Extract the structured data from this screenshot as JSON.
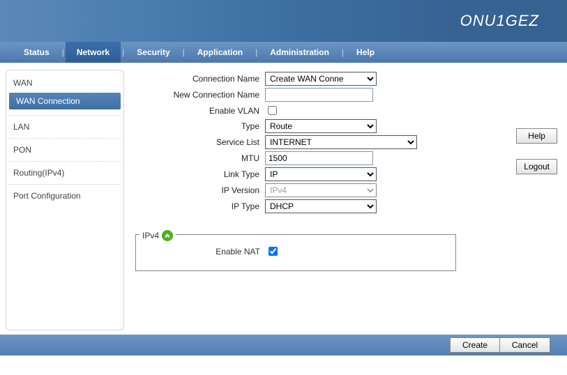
{
  "brand": "ONU1GEZ",
  "menu": {
    "items": [
      "Status",
      "Network",
      "Security",
      "Application",
      "Administration",
      "Help"
    ],
    "active": "Network"
  },
  "sidebar": {
    "groups": [
      {
        "name": "WAN",
        "sub": [
          "WAN Connection"
        ],
        "active_sub": "WAN Connection"
      },
      {
        "name": "LAN"
      },
      {
        "name": "PON"
      },
      {
        "name": "Routing(IPv4)"
      },
      {
        "name": "Port Configuration"
      }
    ]
  },
  "form": {
    "connection_name_label": "Connection Name",
    "connection_name_value": "Create WAN Conne",
    "new_connection_name_label": "New Connection Name",
    "new_connection_name_value": "",
    "enable_vlan_label": "Enable VLAN",
    "enable_vlan_checked": false,
    "type_label": "Type",
    "type_value": "Route",
    "service_list_label": "Service List",
    "service_list_value": "INTERNET",
    "mtu_label": "MTU",
    "mtu_value": "1500",
    "link_type_label": "Link Type",
    "link_type_value": "IP",
    "ip_version_label": "IP Version",
    "ip_version_value": "IPv4",
    "ip_type_label": "IP Type",
    "ip_type_value": "DHCP"
  },
  "ipv4_section": {
    "legend": "IPv4",
    "enable_nat_label": "Enable NAT",
    "enable_nat_checked": true
  },
  "buttons": {
    "help": "Help",
    "logout": "Logout",
    "create": "Create",
    "cancel": "Cancel"
  }
}
